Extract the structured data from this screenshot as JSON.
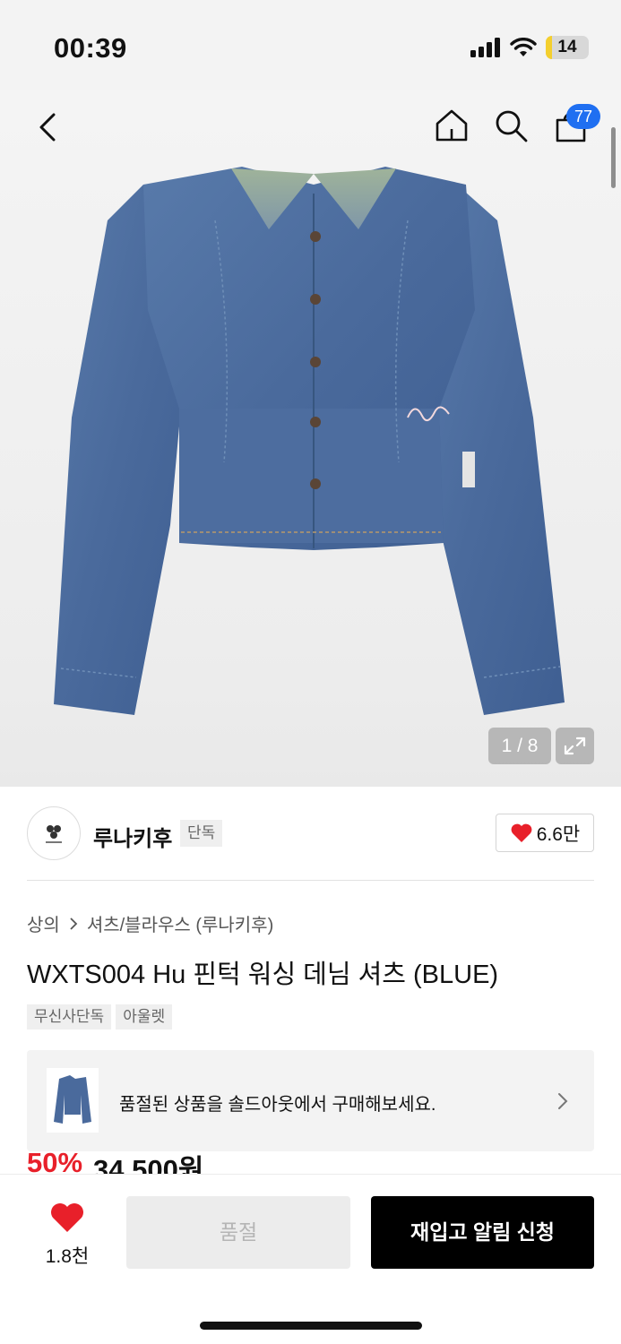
{
  "status_bar": {
    "time": "00:39",
    "battery": "14",
    "battery_level": 0.14
  },
  "nav": {
    "cart_count": "77",
    "icons": [
      "back-icon",
      "home-icon",
      "search-icon",
      "cart-icon"
    ]
  },
  "gallery": {
    "pager": "1 / 8"
  },
  "brand": {
    "name": "루나키후",
    "tag": "단독",
    "likes": "6.6만"
  },
  "product": {
    "breadcrumb": [
      "상의",
      "셔츠/블라우스 (루나키후)"
    ],
    "title": "WXTS004 Hu 핀턱 워싱 데님 셔츠 (BLUE)",
    "tags": [
      "무신사단독",
      "아울렛"
    ],
    "soldout_banner": "품절된 상품을 솔드아웃에서 구매해보세요.",
    "discount": "50%",
    "price": "34,500원"
  },
  "bottom_bar": {
    "wish_count": "1.8천",
    "soldout_label": "품절",
    "restock_label": "재입고 알림 신청"
  },
  "colors": {
    "accent_red": "#e8202a",
    "badge_blue": "#1f6ff1",
    "denim": "#4a6a9c"
  }
}
